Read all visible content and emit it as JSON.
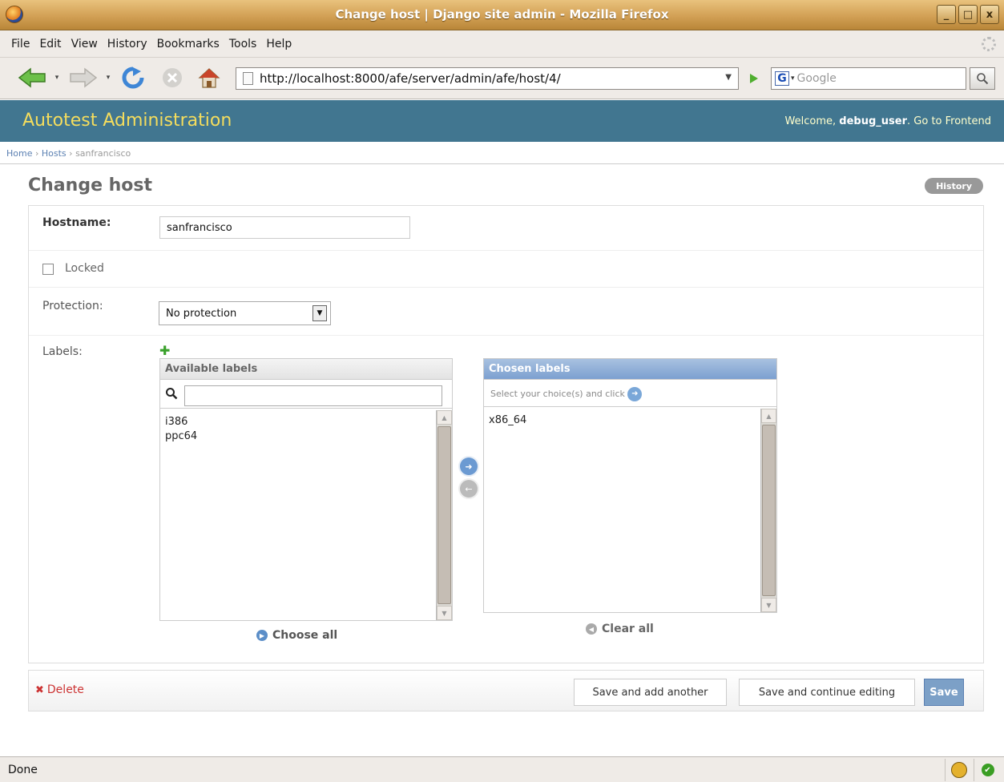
{
  "window": {
    "title": "Change host | Django site admin - Mozilla Firefox",
    "buttons": [
      "_",
      "□",
      "x"
    ]
  },
  "menu": [
    "File",
    "Edit",
    "View",
    "History",
    "Bookmarks",
    "Tools",
    "Help"
  ],
  "navigation": {
    "url": "http://localhost:8000/afe/server/admin/afe/host/4/",
    "search_placeholder": "Google",
    "search_engine_letter": "G"
  },
  "header": {
    "site_title": "Autotest Administration",
    "welcome": "Welcome,",
    "username": "debug_user",
    "after_user": ". Go to Frontend"
  },
  "breadcrumbs": {
    "home": "Home",
    "hosts": "Hosts",
    "current": "sanfrancisco",
    "separator": "›"
  },
  "page": {
    "title": "Change host",
    "history_button": "History"
  },
  "form": {
    "hostname_label": "Hostname:",
    "hostname_value": "sanfrancisco",
    "locked_label": "Locked",
    "locked_checked": false,
    "protection_label": "Protection:",
    "protection_value": "No protection",
    "labels_label": "Labels:",
    "available_header": "Available labels",
    "available_options": [
      "i386",
      "ppc64"
    ],
    "chosen_header": "Chosen labels",
    "chosen_help": "Select your choice(s) and click",
    "chosen_options": [
      "x86_64"
    ],
    "choose_all": "Choose all",
    "clear_all": "Clear all"
  },
  "submit": {
    "delete": "Delete",
    "save_add_another": "Save and add another",
    "save_continue": "Save and continue editing",
    "save": "Save"
  },
  "status": {
    "text": "Done"
  },
  "colors": {
    "header_bg": "#417690",
    "site_title": "#f5dd5d",
    "link": "#5b80b2",
    "chosen_header": "#7ca0d0",
    "delete": "#cc3333",
    "save_button": "#7ca0c7"
  }
}
